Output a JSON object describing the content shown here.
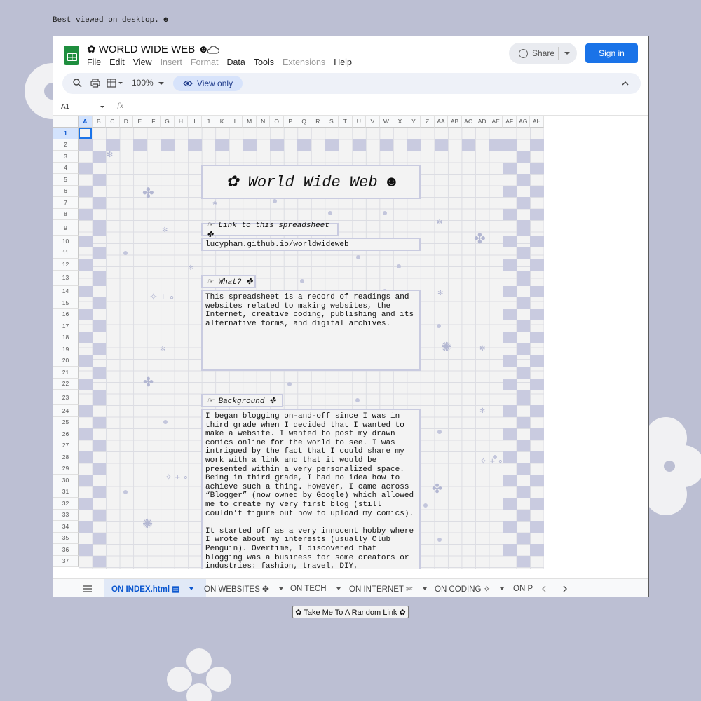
{
  "page_note": "Best viewed on desktop. ☻",
  "doc": {
    "title": "✿ WORLD WIDE WEB ☻",
    "menu": [
      {
        "label": "File",
        "disabled": false
      },
      {
        "label": "Edit",
        "disabled": false
      },
      {
        "label": "View",
        "disabled": false
      },
      {
        "label": "Insert",
        "disabled": true
      },
      {
        "label": "Format",
        "disabled": true
      },
      {
        "label": "Data",
        "disabled": false
      },
      {
        "label": "Tools",
        "disabled": false
      },
      {
        "label": "Extensions",
        "disabled": true
      },
      {
        "label": "Help",
        "disabled": false
      }
    ],
    "share_label": "Share",
    "signin_label": "Sign in"
  },
  "toolbar": {
    "zoom": "100%",
    "view_only_label": "View only"
  },
  "formula_bar": {
    "cell_ref": "A1",
    "fx": "fx"
  },
  "grid": {
    "columns": [
      "A",
      "B",
      "C",
      "D",
      "E",
      "F",
      "G",
      "H",
      "I",
      "J",
      "K",
      "L",
      "M",
      "N",
      "O",
      "P",
      "Q",
      "R",
      "S",
      "T",
      "U",
      "V",
      "W",
      "X",
      "Y",
      "Z",
      "AA",
      "AB",
      "AC",
      "AD",
      "AE",
      "AF",
      "AG",
      "AH"
    ],
    "rows": [
      "1",
      "2",
      "3",
      "4",
      "5",
      "6",
      "7",
      "8",
      "9",
      "10",
      "11",
      "12",
      "13",
      "14",
      "15",
      "16",
      "17",
      "18",
      "19",
      "20",
      "21",
      "22",
      "23",
      "24",
      "25",
      "26",
      "27",
      "28",
      "29",
      "30",
      "31",
      "32",
      "33",
      "34",
      "35",
      "36",
      "37"
    ],
    "selected_cell": "A1"
  },
  "content": {
    "big_title": "✿ World Wide Web ☻",
    "link_label": "☞ Link to this spreadsheet ✤",
    "link_url": "lucypham.github.io/worldwideweb",
    "what_label": "☞ What? ✤",
    "what_text": "This spreadsheet is a record of readings and websites related to making websites, the Internet, creative coding, publishing and its alternative forms, and digital archives.",
    "background_label": "☞ Background ✤",
    "background_text": "I began blogging on-and-off since I was in third grade when I decided that I wanted to make a website. I wanted to post my drawn comics online for the world to see. I was intrigued by the fact that I could share my work with a link and that it would be presented within a very personalized space. Being in third grade, I had no idea how to achieve such a thing. However, I came across “Blogger” (now owned by Google) which allowed me to create my very first blog (still couldn’t figure out how to upload my comics).\n\nIt started off as a very innocent hobby where I wrote about my interests (usually Club Penguin). Overtime, I discovered that blogging was a business for some creators or industries: fashion, travel, DIY, photography, lifestyle,"
  },
  "sheet_tabs": [
    {
      "label": "ON INDEX.html ▤",
      "active": true
    },
    {
      "label": "ON WEBSITES ✤",
      "active": false
    },
    {
      "label": "ON TECH",
      "active": false
    },
    {
      "label": "ON INTERNET ✄",
      "active": false
    },
    {
      "label": "ON CODING ✧",
      "active": false
    },
    {
      "label": "ON P",
      "active": false
    }
  ],
  "random_button": "✿ Take Me To A Random Link ✿",
  "colors": {
    "background": "#bcbfd3",
    "accent_blue": "#1a73e8",
    "checker": "#c9cbe0",
    "cell_bg": "#f3f3f3"
  }
}
